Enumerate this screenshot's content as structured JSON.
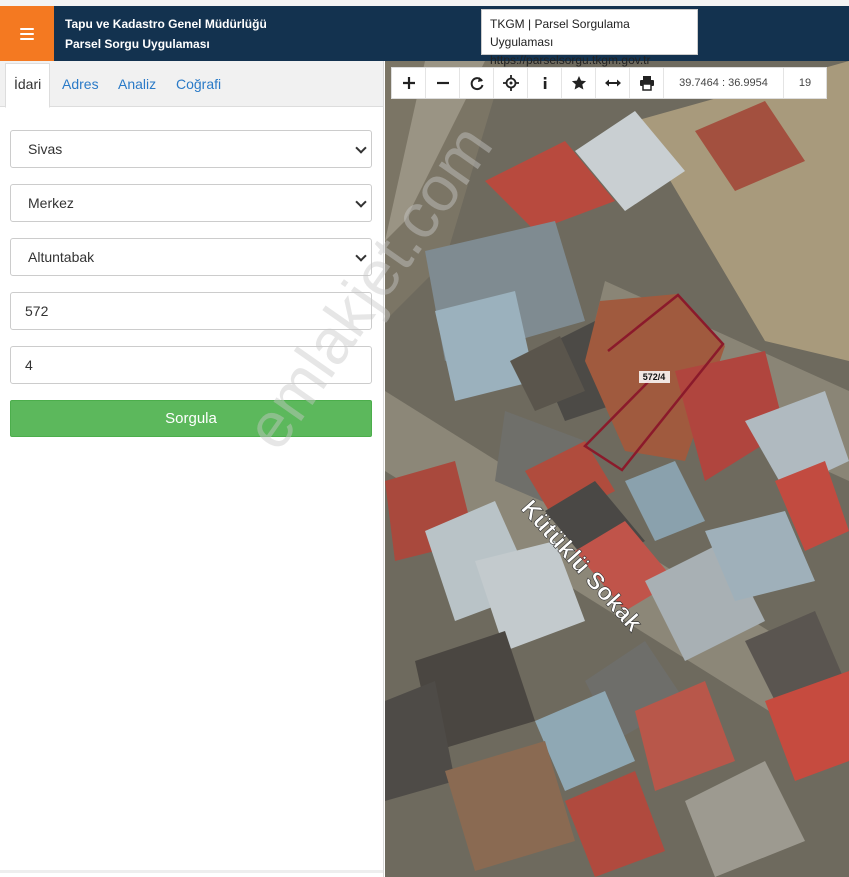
{
  "header": {
    "title_line1": "Tapu ve Kadastro Genel Müdürlüğü",
    "title_line2": "Parsel Sorgu Uygulaması",
    "menu_icon": "hamburger-icon"
  },
  "tooltip": {
    "line1": "TKGM | Parsel Sorgulama Uygulaması",
    "line2": "https://parselsorgu.tkgm.gov.tr"
  },
  "tabs": [
    {
      "label": "İdari",
      "active": true
    },
    {
      "label": "Adres"
    },
    {
      "label": "Analiz"
    },
    {
      "label": "Coğrafi"
    }
  ],
  "form": {
    "il": "Sivas",
    "ilce": "Merkez",
    "mahalle": "Altuntabak",
    "ada": "572",
    "parsel": "4",
    "submit_label": "Sorgula"
  },
  "map": {
    "toolbar_icons": [
      "zoom-in-icon",
      "zoom-out-icon",
      "refresh-icon",
      "locate-icon",
      "info-icon",
      "star-icon",
      "measure-icon",
      "print-icon"
    ],
    "coordinates": "39.7464 : 36.9954",
    "zoom_level": "19",
    "parcel_label": "572/4",
    "street_label": "Kütüklü Sokak",
    "parcel_outline_color": "#8b1a2b"
  },
  "watermark": "emlakjet.com"
}
